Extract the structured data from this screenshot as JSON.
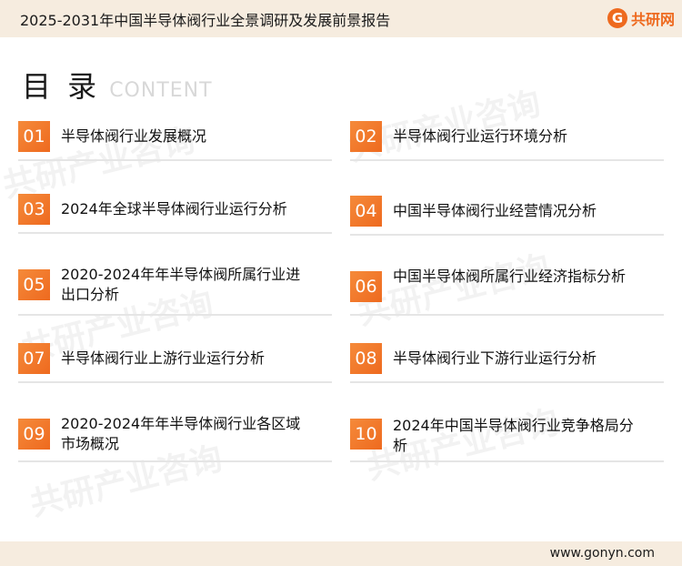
{
  "header": {
    "title": "2025-2031年中国半导体阀行业全景调研及发展前景报告",
    "logo_mark": "G",
    "logo_text": "共研网"
  },
  "heading": {
    "main": "目 录",
    "sub": "CONTENT"
  },
  "watermark": {
    "text": "共研产业咨询",
    "url_text": "www.gonyn.com"
  },
  "toc": [
    {
      "num": "01",
      "label": "半导体阀行业发展概况"
    },
    {
      "num": "02",
      "label": "半导体阀行业运行环境分析"
    },
    {
      "num": "03",
      "label": "2024年全球半导体阀行业运行分析"
    },
    {
      "num": "04",
      "label": "中国半导体阀行业经营情况分析"
    },
    {
      "num": "05",
      "label": "2020-2024年年半导体阀所属行业进出口分析"
    },
    {
      "num": "06",
      "label": "中国半导体阀所属行业经济指标分析"
    },
    {
      "num": "07",
      "label": "半导体阀行业上游行业运行分析"
    },
    {
      "num": "08",
      "label": "半导体阀行业下游行业运行分析"
    },
    {
      "num": "09",
      "label": "2020-2024年年半导体阀行业各区域市场概况"
    },
    {
      "num": "10",
      "label": "2024年中国半导体阀行业竞争格局分析"
    }
  ],
  "footer": {
    "url": "www.gonyn.com"
  },
  "colors": {
    "accent": "#ee6a1f",
    "band": "#f6ecdf"
  }
}
